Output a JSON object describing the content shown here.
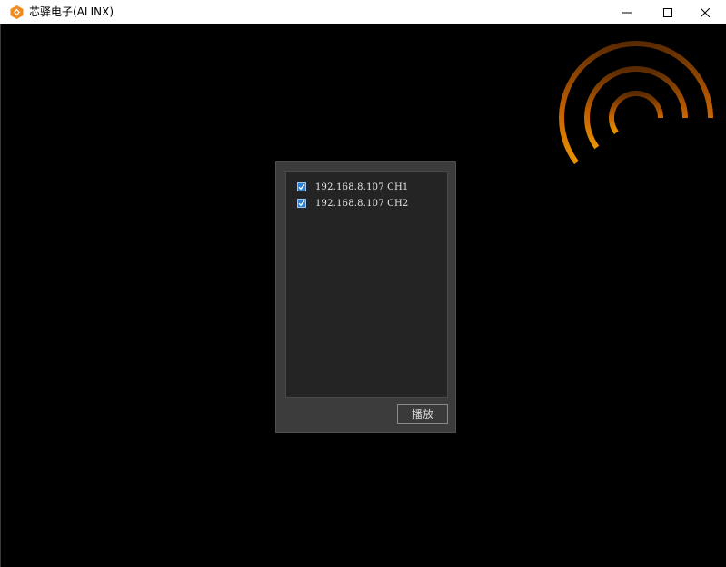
{
  "window": {
    "title": "芯驿电子(ALINX)",
    "icon": "alinx-logo-icon",
    "controls": [
      "minimize-icon",
      "maximize-icon",
      "close-icon"
    ]
  },
  "dialog": {
    "channels": [
      {
        "label": "192.168.8.107 CH1",
        "checked": true
      },
      {
        "label": "192.168.8.107 CH2",
        "checked": true
      }
    ],
    "play_label": "播放"
  },
  "colors": {
    "background": "#000000",
    "accent_orange": "#ff8a00",
    "checkbox_blue": "#2d7fd1"
  }
}
